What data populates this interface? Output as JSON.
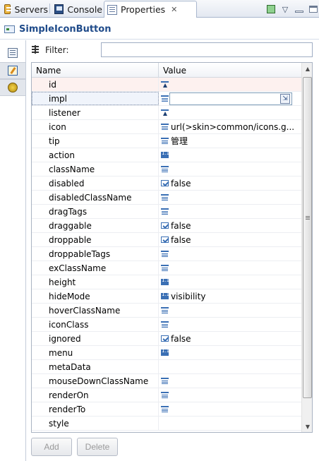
{
  "tabs": [
    {
      "label": "Servers",
      "icon": "servers-icon"
    },
    {
      "label": "Console",
      "icon": "console-icon"
    },
    {
      "label": "Properties",
      "icon": "properties-icon",
      "active": true
    }
  ],
  "header": {
    "title": "SimpleIconButton"
  },
  "filter": {
    "label": "Filter:",
    "value": ""
  },
  "table": {
    "columns": [
      "Name",
      "Value"
    ],
    "rows": [
      {
        "name": "id",
        "type": "fn",
        "value": ""
      },
      {
        "name": "impl",
        "type": "str",
        "value": ""
      },
      {
        "name": "listener",
        "type": "fn",
        "value": ""
      },
      {
        "name": "icon",
        "type": "str",
        "value": "url(>skin>common/icons.g..."
      },
      {
        "name": "tip",
        "type": "str",
        "value": "管理"
      },
      {
        "name": "action",
        "type": "num",
        "value": ""
      },
      {
        "name": "className",
        "type": "str",
        "value": ""
      },
      {
        "name": "disabled",
        "type": "bool",
        "value": "false"
      },
      {
        "name": "disabledClassName",
        "type": "str",
        "value": ""
      },
      {
        "name": "dragTags",
        "type": "str",
        "value": ""
      },
      {
        "name": "draggable",
        "type": "bool",
        "value": "false"
      },
      {
        "name": "droppable",
        "type": "bool",
        "value": "false"
      },
      {
        "name": "droppableTags",
        "type": "str",
        "value": ""
      },
      {
        "name": "exClassName",
        "type": "str",
        "value": ""
      },
      {
        "name": "height",
        "type": "num",
        "value": ""
      },
      {
        "name": "hideMode",
        "type": "num",
        "value": "visibility"
      },
      {
        "name": "hoverClassName",
        "type": "str",
        "value": ""
      },
      {
        "name": "iconClass",
        "type": "str",
        "value": ""
      },
      {
        "name": "ignored",
        "type": "bool",
        "value": "false"
      },
      {
        "name": "menu",
        "type": "num",
        "value": ""
      },
      {
        "name": "metaData",
        "type": "none",
        "value": ""
      },
      {
        "name": "mouseDownClassName",
        "type": "str",
        "value": ""
      },
      {
        "name": "renderOn",
        "type": "str",
        "value": ""
      },
      {
        "name": "renderTo",
        "type": "str",
        "value": ""
      },
      {
        "name": "style",
        "type": "none",
        "value": ""
      }
    ]
  },
  "buttons": {
    "add": "Add",
    "delete": "Delete"
  }
}
